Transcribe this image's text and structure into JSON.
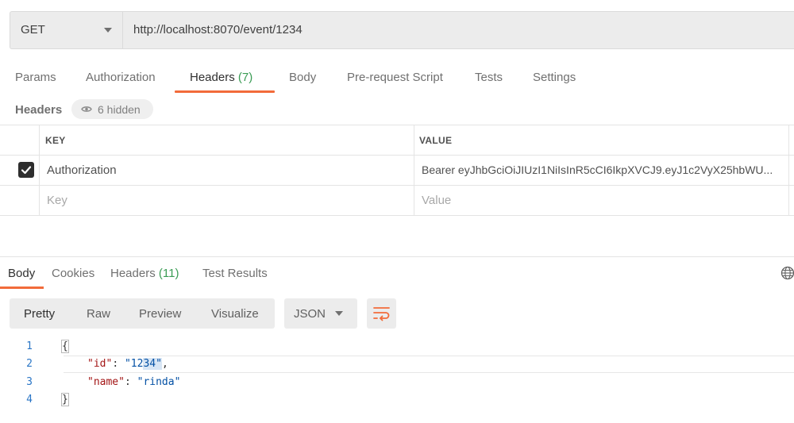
{
  "request": {
    "method": "GET",
    "url": "http://localhost:8070/event/1234"
  },
  "request_tabs": [
    {
      "label": "Params"
    },
    {
      "label": "Authorization"
    },
    {
      "label": "Headers",
      "count": "(7)",
      "active": true
    },
    {
      "label": "Body"
    },
    {
      "label": "Pre-request Script"
    },
    {
      "label": "Tests"
    },
    {
      "label": "Settings"
    }
  ],
  "headers_section": {
    "title": "Headers",
    "hidden_label": "6 hidden"
  },
  "headers_table": {
    "columns": [
      "KEY",
      "VALUE"
    ],
    "rows": [
      {
        "checked": true,
        "key": "Authorization",
        "value": "Bearer eyJhbGciOiJIUzI1NiIsInR5cCI6IkpXVCJ9.eyJ1c2VyX25hbWU..."
      }
    ],
    "placeholder_key": "Key",
    "placeholder_value": "Value"
  },
  "response_tabs": [
    {
      "label": "Body",
      "active": true
    },
    {
      "label": "Cookies"
    },
    {
      "label": "Headers",
      "count": "(11)"
    },
    {
      "label": "Test Results"
    }
  ],
  "response_toolbar": {
    "views": [
      "Pretty",
      "Raw",
      "Preview",
      "Visualize"
    ],
    "active_view": "Pretty",
    "format": "JSON"
  },
  "response_body": {
    "line_numbers": [
      "1",
      "2",
      "3",
      "4"
    ],
    "open_brace": "{",
    "close_brace": "}",
    "id_key": "\"id\"",
    "id_value_a": "\"12",
    "id_value_b": "34\"",
    "name_key": "\"name\"",
    "name_value": "\"rinda\""
  },
  "colors": {
    "accent": "#f26b3a",
    "count_green": "#3a9c54",
    "json_key": "#a31515",
    "json_string": "#0451a5"
  },
  "icons": [
    "chevron-down-icon",
    "eye-icon",
    "checkbox-checked-icon",
    "globe-icon",
    "wrap-lines-icon"
  ]
}
